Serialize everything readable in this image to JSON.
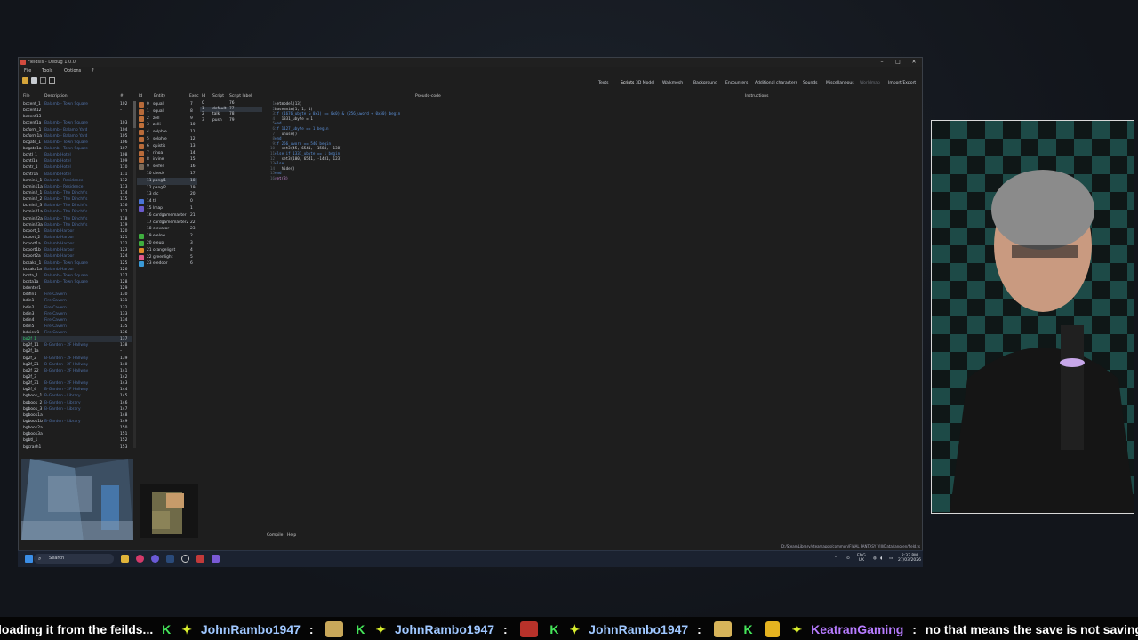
{
  "window": {
    "title": "FieldsIs - Debug 1.0.0",
    "controls": [
      "–",
      "□",
      "✕"
    ]
  },
  "menu": [
    "File",
    "Tools",
    "Options",
    "?"
  ],
  "tabs": [
    "Texts",
    "Scripts",
    "3D Model",
    "Walkmesh",
    "Background",
    "Encounters",
    "Additional characters",
    "Sounds",
    "Miscellaneous",
    "Worldmap",
    "Import/Export"
  ],
  "active_tab": "Scripts",
  "field_list": {
    "headers": {
      "file": "File",
      "description": "Description",
      "number": "#"
    },
    "rows": [
      {
        "file": "bccent_1",
        "desc": "Balamb - Town Square",
        "num": "102"
      },
      {
        "file": "bccent12",
        "desc": "",
        "num": "–"
      },
      {
        "file": "bccent13",
        "desc": "",
        "num": "–"
      },
      {
        "file": "bccent1a",
        "desc": "Balamb - Town Square",
        "num": "103"
      },
      {
        "file": "bcform_1",
        "desc": "Balamb - Balamb Yard",
        "num": "104"
      },
      {
        "file": "bcform1a",
        "desc": "Balamb - Balamb Yard",
        "num": "105"
      },
      {
        "file": "bcgate_1",
        "desc": "Balamb - Town Square",
        "num": "106"
      },
      {
        "file": "bcgate1a",
        "desc": "Balamb - Town Square",
        "num": "107"
      },
      {
        "file": "bchtl_1",
        "desc": "Balamb Hotel",
        "num": "108"
      },
      {
        "file": "bchtl1a",
        "desc": "Balamb Hotel",
        "num": "109"
      },
      {
        "file": "bchtr_1",
        "desc": "Balamb Hotel",
        "num": "110"
      },
      {
        "file": "bchtr1a",
        "desc": "Balamb Hotel",
        "num": "111"
      },
      {
        "file": "bcmin1_1",
        "desc": "Balamb - Residence",
        "num": "112"
      },
      {
        "file": "bcmin11a",
        "desc": "Balamb - Residence",
        "num": "113"
      },
      {
        "file": "bcmin2_1",
        "desc": "Balamb - The Dincht's",
        "num": "114"
      },
      {
        "file": "bcmin2_2",
        "desc": "Balamb - The Dincht's",
        "num": "115"
      },
      {
        "file": "bcmin2_3",
        "desc": "Balamb - The Dincht's",
        "num": "116"
      },
      {
        "file": "bcmin21a",
        "desc": "Balamb - The Dincht's",
        "num": "117"
      },
      {
        "file": "bcmin22a",
        "desc": "Balamb - The Dincht's",
        "num": "118"
      },
      {
        "file": "bcmin23a",
        "desc": "Balamb - The Dincht's",
        "num": "119"
      },
      {
        "file": "bcport_1",
        "desc": "Balamb Harbor",
        "num": "120"
      },
      {
        "file": "bcport_2",
        "desc": "Balamb Harbor",
        "num": "121"
      },
      {
        "file": "bcport1a",
        "desc": "Balamb Harbor",
        "num": "122"
      },
      {
        "file": "bcport1b",
        "desc": "Balamb Harbor",
        "num": "123"
      },
      {
        "file": "bcport2a",
        "desc": "Balamb Harbor",
        "num": "124"
      },
      {
        "file": "bcsaka_1",
        "desc": "Balamb - Town Square",
        "num": "125"
      },
      {
        "file": "bcsaka1a",
        "desc": "Balamb Harbor",
        "num": "126"
      },
      {
        "file": "bcsta_1",
        "desc": "Balamb - Town Square",
        "num": "127"
      },
      {
        "file": "bcsta1a",
        "desc": "Balamb - Town Square",
        "num": "128"
      },
      {
        "file": "bdenter1",
        "desc": "",
        "num": "129"
      },
      {
        "file": "bdifin1",
        "desc": "Fire Cavern",
        "num": "130"
      },
      {
        "file": "bdin1",
        "desc": "Fire Cavern",
        "num": "131"
      },
      {
        "file": "bdin2",
        "desc": "Fire Cavern",
        "num": "132"
      },
      {
        "file": "bdin3",
        "desc": "Fire Cavern",
        "num": "133"
      },
      {
        "file": "bdin4",
        "desc": "Fire Cavern",
        "num": "134"
      },
      {
        "file": "bdin5",
        "desc": "Fire Cavern",
        "num": "135"
      },
      {
        "file": "bdview1",
        "desc": "Fire Cavern",
        "num": "136"
      },
      {
        "file": "bg2f_1",
        "desc": "",
        "num": "137"
      },
      {
        "file": "bg2f_11",
        "desc": "B-Garden - 2F Hallway",
        "num": "138"
      },
      {
        "file": "bg2f_1a",
        "desc": "",
        "num": "–"
      },
      {
        "file": "bg2f_2",
        "desc": "B-Garden - 2F Hallway",
        "num": "139"
      },
      {
        "file": "bg2f_21",
        "desc": "B-Garden - 2F Hallway",
        "num": "140"
      },
      {
        "file": "bg2f_22",
        "desc": "B-Garden - 2F Hallway",
        "num": "141"
      },
      {
        "file": "bg2f_3",
        "desc": "",
        "num": "142"
      },
      {
        "file": "bg2f_31",
        "desc": "B-Garden - 2F Hallway",
        "num": "143"
      },
      {
        "file": "bg2f_4",
        "desc": "B-Garden - 2F Hallway",
        "num": "144"
      },
      {
        "file": "bgbook_1",
        "desc": "B-Garden - Library",
        "num": "145"
      },
      {
        "file": "bgbook_2",
        "desc": "B-Garden - Library",
        "num": "146"
      },
      {
        "file": "bgbook_3",
        "desc": "B-Garden - Library",
        "num": "147"
      },
      {
        "file": "bgbook1a",
        "desc": "",
        "num": "148"
      },
      {
        "file": "bgbook1b",
        "desc": "B-Garden - Library",
        "num": "149"
      },
      {
        "file": "bgbook2a",
        "desc": "",
        "num": "150"
      },
      {
        "file": "bgbook3a",
        "desc": "",
        "num": "151"
      },
      {
        "file": "bgbtl_1",
        "desc": "",
        "num": "152"
      },
      {
        "file": "bgcrash1",
        "desc": "",
        "num": "153"
      }
    ],
    "selected_index": 37
  },
  "entity_list": {
    "headers": {
      "id": "Id",
      "entity": "Entity",
      "exec": "Exec"
    },
    "rows": [
      {
        "id": "0",
        "name": "squall",
        "exec": "7",
        "color": "#b86b3a"
      },
      {
        "id": "1",
        "name": "squall",
        "exec": "8",
        "color": "#b86b3a"
      },
      {
        "id": "2",
        "name": "zell",
        "exec": "9",
        "color": "#c0703a"
      },
      {
        "id": "3",
        "name": "zelli",
        "exec": "10",
        "color": "#c0703a"
      },
      {
        "id": "4",
        "name": "selphie",
        "exec": "11",
        "color": "#b86b3a"
      },
      {
        "id": "5",
        "name": "selphie",
        "exec": "12",
        "color": "#b86b3a"
      },
      {
        "id": "6",
        "name": "quistis",
        "exec": "13",
        "color": "#b86b3a"
      },
      {
        "id": "7",
        "name": "rinoa",
        "exec": "14",
        "color": "#b86b3a"
      },
      {
        "id": "8",
        "name": "irvine",
        "exec": "15",
        "color": "#b86b3a"
      },
      {
        "id": "9",
        "name": "seifer",
        "exec": "16",
        "color": "#7a6a5a"
      },
      {
        "id": "10",
        "name": "check",
        "exec": "17",
        "color": ""
      },
      {
        "id": "11",
        "name": "pangl1",
        "exec": "18",
        "color": ""
      },
      {
        "id": "12",
        "name": "pangl2",
        "exec": "19",
        "color": ""
      },
      {
        "id": "13",
        "name": "dic",
        "exec": "20",
        "color": ""
      },
      {
        "id": "14",
        "name": "tl",
        "exec": "0",
        "color": "#4a74d6"
      },
      {
        "id": "15",
        "name": "lmap",
        "exec": "1",
        "color": "#6a5acd"
      },
      {
        "id": "16",
        "name": "cardgamemaster",
        "exec": "21",
        "color": ""
      },
      {
        "id": "17",
        "name": "cardgamemaster2",
        "exec": "22",
        "color": ""
      },
      {
        "id": "18",
        "name": "elevator",
        "exec": "23",
        "color": ""
      },
      {
        "id": "19",
        "name": "elelow",
        "exec": "2",
        "color": "#3fae3f"
      },
      {
        "id": "20",
        "name": "eleup",
        "exec": "3",
        "color": "#3fae3f"
      },
      {
        "id": "21",
        "name": "orangelight",
        "exec": "4",
        "color": "#e08a2a"
      },
      {
        "id": "22",
        "name": "greenlight",
        "exec": "5",
        "color": "#e05a8a"
      },
      {
        "id": "23",
        "name": "eledoor",
        "exec": "6",
        "color": "#3a9ad6"
      }
    ],
    "selected_index": 11
  },
  "script_list": {
    "headers": {
      "id": "Id",
      "script": "Script",
      "label": "Script label"
    },
    "rows": [
      {
        "id": "0",
        "script": "",
        "label": "76"
      },
      {
        "id": "1",
        "script": "default",
        "label": "77"
      },
      {
        "id": "2",
        "script": "talk",
        "label": "78"
      },
      {
        "id": "3",
        "script": "push",
        "label": "79"
      }
    ],
    "selected_index": 1
  },
  "code_panel": {
    "headers": {
      "pseudo": "Pseudo-code",
      "instructions": "Instructions"
    },
    "lines": [
      "setmodel(13)",
      "baseanim(1, 1, 1)",
      "if (1676_ubyte & 0x1) == 0x0) & (256_uword < 0x50) begin",
      "   1331_ubyte = 1",
      "end",
      "if 1127_ubyte == 1 begin",
      "   unuse()",
      "end",
      "if 256_uword == 540 begin",
      "   set3(45, 6541, -1584, -138)",
      "else if 1331_ubyte == 1 begin",
      "   set3(100, 6541, -1481, 123)",
      "else",
      "   hide()",
      "end",
      "ret(8)"
    ]
  },
  "bottom_buttons": [
    "Compile",
    "Help"
  ],
  "status_path": "D:/SteamLibrary/steamapps/common/FINAL FANTASY VIII/Data/lang-en/field.fs",
  "taskbar": {
    "search_placeholder": "Search",
    "lang_line1": "ENG",
    "lang_line2": "UK",
    "time": "2:33 PM",
    "date": "27/03/2026"
  },
  "ticker": {
    "lead_text": "loading it from the feilds...",
    "user1": "JohnRambo1947",
    "user2": "KeatranGaming",
    "last_message": "no that means the save is not saving the change...",
    "sep": ":"
  },
  "colors": {
    "accent_green": "#37c86a",
    "desc_blue": "#4f6fa5",
    "ticker_name": "#9fc7ff",
    "ticker_name2": "#b77cff"
  },
  "icons": [
    "folder-icon",
    "save-icon",
    "search-icon",
    "windows-start-icon",
    "file-explorer-icon",
    "chrome-icon",
    "steam-icon"
  ]
}
